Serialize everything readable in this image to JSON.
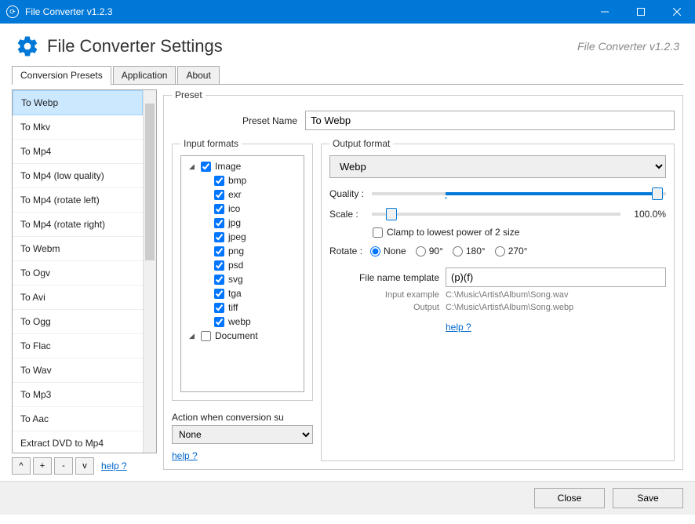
{
  "window": {
    "title": "File Converter v1.2.3"
  },
  "header": {
    "title": "File Converter Settings",
    "version": "File Converter v1.2.3"
  },
  "tabs": {
    "presets": "Conversion Presets",
    "application": "Application",
    "about": "About"
  },
  "presets": [
    "To Webp",
    "To Mkv",
    "To Mp4",
    "To Mp4 (low quality)",
    "To Mp4 (rotate left)",
    "To Mp4 (rotate right)",
    "To Webm",
    "To Ogv",
    "To Avi",
    "To Ogg",
    "To Flac",
    "To Wav",
    "To Mp3",
    "To Aac",
    "Extract DVD to Mp4"
  ],
  "preset_selected_index": 0,
  "preset_buttons": {
    "up": "^",
    "add": "+",
    "remove": "-",
    "down": "v",
    "help": "help ?"
  },
  "preset_panel": {
    "legend": "Preset",
    "name_label": "Preset Name",
    "name_value": "To Webp"
  },
  "input_formats": {
    "legend": "Input formats",
    "groups": [
      {
        "label": "Image",
        "expanded": true,
        "checked": true,
        "items": [
          "bmp",
          "exr",
          "ico",
          "jpg",
          "jpeg",
          "png",
          "psd",
          "svg",
          "tga",
          "tiff",
          "webp"
        ]
      },
      {
        "label": "Document",
        "expanded": true,
        "checked": false,
        "items": []
      }
    ],
    "action_label": "Action when conversion su",
    "action_value": "None",
    "help": "help ?"
  },
  "output": {
    "legend": "Output format",
    "format": "Webp",
    "quality_label": "Quality :",
    "quality_percent": 97,
    "scale_label": "Scale :",
    "scale_percent": 8,
    "scale_text": "100.0%",
    "clamp_label": "Clamp to lowest power of 2 size",
    "clamp_checked": false,
    "rotate_label": "Rotate :",
    "rotate_options": [
      "None",
      "90°",
      "180°",
      "270°"
    ],
    "rotate_selected": "None",
    "filename_label": "File name template",
    "filename_value": "(p)(f)",
    "input_example_label": "Input example",
    "input_example_value": "C:\\Music\\Artist\\Album\\Song.wav",
    "output_example_label": "Output",
    "output_example_value": "C:\\Music\\Artist\\Album\\Song.webp",
    "help": "help ?"
  },
  "footer": {
    "close": "Close",
    "save": "Save"
  }
}
